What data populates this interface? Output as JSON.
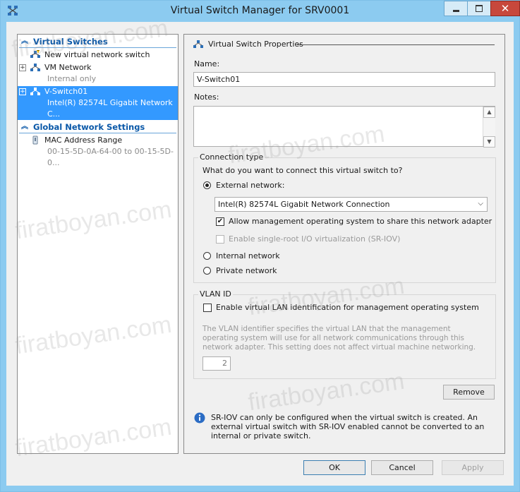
{
  "window": {
    "title": "Virtual Switch Manager for SRV0001",
    "close_glyph": "✕"
  },
  "left": {
    "virtual_switches_header": "Virtual Switches",
    "items": [
      {
        "label": "New virtual network switch",
        "sub": ""
      },
      {
        "label": "VM Network",
        "sub": "Internal only",
        "expand": "+"
      },
      {
        "label": "V-Switch01",
        "sub": "Intel(R) 82574L Gigabit Network C...",
        "expand": "+"
      }
    ],
    "global_header": "Global Network Settings",
    "global_items": [
      {
        "label": "MAC Address Range",
        "sub": "00-15-5D-0A-64-00 to 00-15-5D-0..."
      }
    ]
  },
  "right": {
    "header": "Virtual Switch Properties",
    "name_label": "Name:",
    "name_value": "V-Switch01",
    "notes_label": "Notes:",
    "notes_value": "",
    "connection_type": {
      "title": "Connection type",
      "question": "What do you want to connect this virtual switch to?",
      "external_label": "External network:",
      "adapter_value": "Intel(R) 82574L Gigabit Network Connection",
      "allow_mgmt_label": "Allow management operating system to share this network adapter",
      "sriov_label": "Enable single-root I/O virtualization (SR-IOV)",
      "internal_label": "Internal network",
      "private_label": "Private network"
    },
    "vlan": {
      "title": "VLAN ID",
      "enable_label": "Enable virtual LAN identification for management operating system",
      "desc": "The VLAN identifier specifies the virtual LAN that the management operating system will use for all network communications through this network adapter. This setting does not affect virtual machine networking.",
      "value": "2"
    },
    "remove_label": "Remove",
    "info_text": "SR-IOV can only be configured when the virtual switch is created. An external virtual switch with SR-IOV enabled cannot be converted to an internal or private switch."
  },
  "footer": {
    "ok": "OK",
    "cancel": "Cancel",
    "apply": "Apply"
  },
  "watermark": "firatboyan.com",
  "colors": {
    "selection": "#3399ff",
    "section_header": "#0a58a8",
    "close": "#c7483c"
  }
}
